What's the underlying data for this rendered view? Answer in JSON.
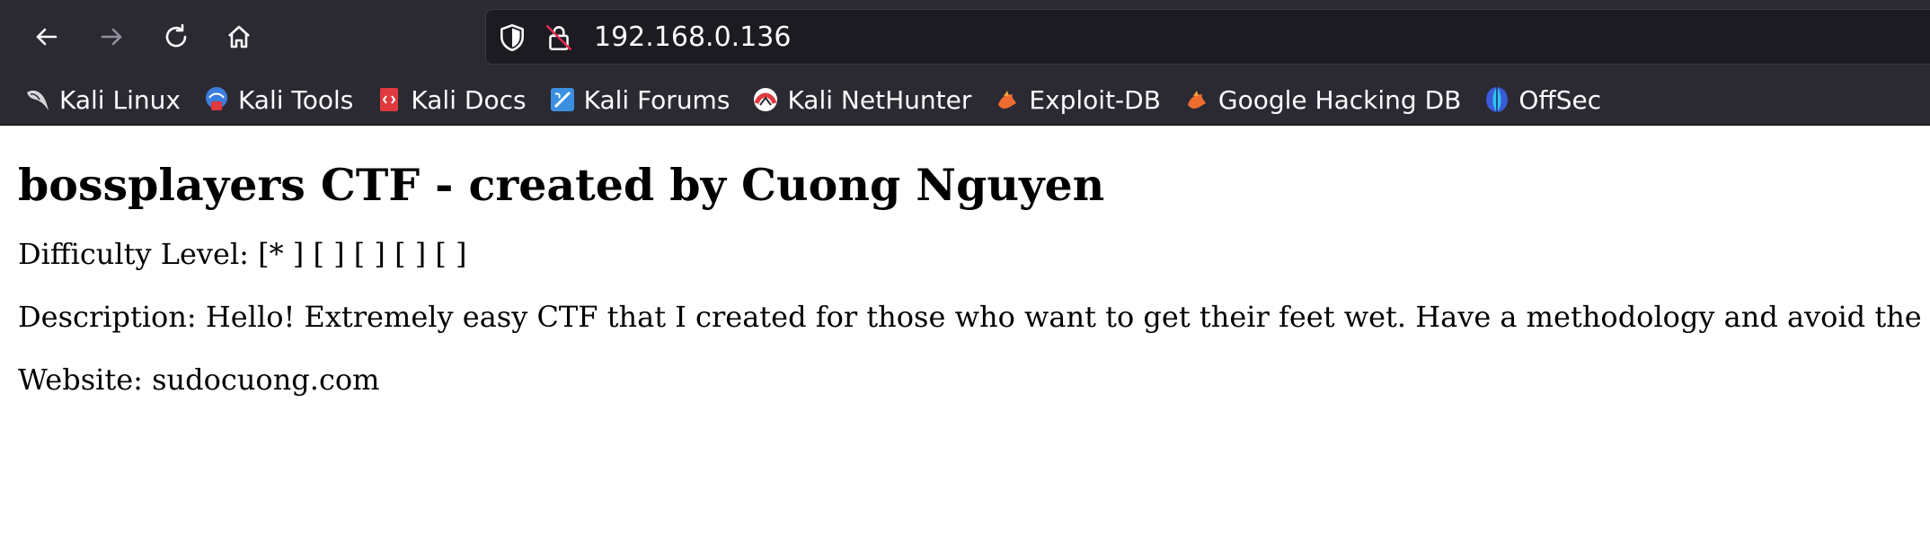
{
  "browser": {
    "url": "192.168.0.136",
    "bookmarks": [
      {
        "label": "Kali Linux",
        "icon": "kali-dragon-icon"
      },
      {
        "label": "Kali Tools",
        "icon": "kali-tools-icon"
      },
      {
        "label": "Kali Docs",
        "icon": "kali-docs-icon"
      },
      {
        "label": "Kali Forums",
        "icon": "kali-forums-icon"
      },
      {
        "label": "Kali NetHunter",
        "icon": "kali-nethunter-icon"
      },
      {
        "label": "Exploit-DB",
        "icon": "exploit-db-icon"
      },
      {
        "label": "Google Hacking DB",
        "icon": "google-hacking-db-icon"
      },
      {
        "label": "OffSec",
        "icon": "offsec-icon"
      }
    ]
  },
  "page": {
    "title": "bossplayers CTF - created by Cuong Nguyen",
    "difficulty": "Difficulty Level: [* ] [ ] [ ] [ ] [ ]",
    "description": "Description: Hello! Extremely easy CTF that I created for those who want to get their feet wet. Have a methodology and avoid the",
    "website": "Website: sudocuong.com"
  },
  "colors": {
    "chrome_bg": "#2b2a33",
    "urlbar_bg": "#1c1b22",
    "chrome_text": "#fbfbfe",
    "page_bg": "#ffffff"
  }
}
